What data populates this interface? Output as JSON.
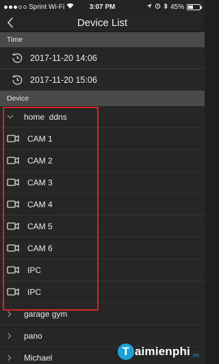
{
  "status_bar": {
    "carrier": "Sprint Wi-Fi",
    "time": "3:07 PM",
    "battery": "45%",
    "battery_level": 0.45
  },
  "nav": {
    "title": "Device List"
  },
  "time_section": {
    "header": "Time",
    "items": [
      {
        "label": "2017-11-20 14:06"
      },
      {
        "label": "2017-11-20 15:06"
      }
    ]
  },
  "device_section": {
    "header": "Device",
    "group": {
      "label": "home  ddns",
      "expanded": true
    },
    "channels": [
      {
        "label": "CAM 1"
      },
      {
        "label": "CAM 2"
      },
      {
        "label": "CAM 3"
      },
      {
        "label": "CAM 4"
      },
      {
        "label": "CAM 5"
      },
      {
        "label": "CAM 6"
      },
      {
        "label": "IPC"
      },
      {
        "label": "IPC"
      }
    ],
    "other_groups": [
      {
        "label": "garage gym"
      },
      {
        "label": "pano"
      },
      {
        "label": "Michael"
      }
    ]
  },
  "watermark": {
    "initial": "T",
    "text": "aimienphi",
    "suffix": ".vn"
  },
  "colors": {
    "highlight": "#d8232a",
    "section_header": "#4a4a4a",
    "background": "#262626",
    "watermark_accent": "#1da1d6"
  }
}
